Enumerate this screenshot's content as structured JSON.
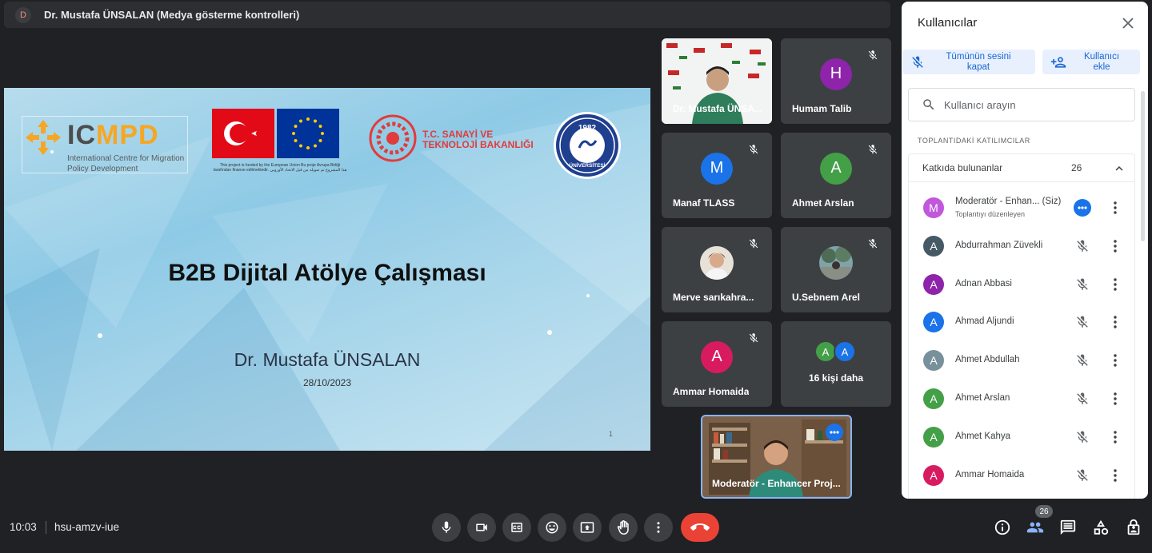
{
  "presenter": {
    "initial": "D",
    "title": "Dr. Mustafa ÜNSALAN (Medya gösterme kontrolleri)"
  },
  "slide": {
    "icmpd_name_a": "IC",
    "icmpd_name_b": "MPD",
    "icmpd_sub": "International Centre for Migration Policy Development",
    "eu_caption": "This project is funded by the European Union Bu proje Avrupa Birliği tarafından finanse edilmektedir. هذا المشروع تم تمويله من قبل الاتحاد الأوروبي",
    "ministry": "T.C. SANAYİ VE TEKNOLOJİ BAKANLIĞI",
    "uni_year": "1982",
    "uni_text": "ÜNİVERSİTESİ",
    "title": "B2B Dijital Atölye Çalışması",
    "author": "Dr. Mustafa ÜNSALAN",
    "date": "28/10/2023",
    "page": "1"
  },
  "tiles": [
    {
      "name": "Dr. Mustafa ÜNSA...",
      "type": "video"
    },
    {
      "name": "Humam Talib",
      "initial": "H",
      "color": "#8e24aa",
      "muted": true
    },
    {
      "name": "Manaf TLASS",
      "initial": "M",
      "color": "#1a73e8",
      "muted": true
    },
    {
      "name": "Ahmet Arslan",
      "initial": "A",
      "color": "#43a047",
      "muted": true
    },
    {
      "name": "Merve sarıkahra...",
      "type": "photo",
      "muted": true
    },
    {
      "name": "U.Sebnem Arel",
      "type": "photo",
      "muted": true
    },
    {
      "name": "Ammar Homaida",
      "initial": "A",
      "color": "#d81b60",
      "muted": true
    },
    {
      "more_label": "16 kişi daha",
      "initials": [
        "A",
        "A"
      ],
      "colors": [
        "#43a047",
        "#1a73e8"
      ]
    }
  ],
  "self_tile": {
    "name": "Moderatör - Enhancer Proj..."
  },
  "panel": {
    "title": "Kullanıcılar",
    "mute_all": "Tümünün sesini kapat",
    "add_user": "Kullanıcı ekle",
    "search_placeholder": "Kullanıcı arayın",
    "section": "TOPLANTIDAKİ KATILIMCILAR",
    "contributors_label": "Katkıda bulunanlar",
    "contributors_count": "26",
    "participants": [
      {
        "initial": "M",
        "color": "#c158dc",
        "name": "Moderatör - Enhan... (Siz)",
        "sub": "Toplantıyı düzenleyen",
        "speaking": true
      },
      {
        "initial": "A",
        "color": "#455a64",
        "name": "Abdurrahman Züvekli"
      },
      {
        "initial": "A",
        "color": "#8e24aa",
        "name": "Adnan Abbasi"
      },
      {
        "initial": "A",
        "color": "#1a73e8",
        "name": "Ahmad Aljundi"
      },
      {
        "initial": "A",
        "color": "#78909c",
        "name": "Ahmet Abdullah"
      },
      {
        "initial": "A",
        "color": "#43a047",
        "name": "Ahmet Arslan"
      },
      {
        "initial": "A",
        "color": "#43a047",
        "name": "Ahmet Kahya"
      },
      {
        "initial": "A",
        "color": "#d81b60",
        "name": "Ammar Homaida"
      }
    ]
  },
  "bottom": {
    "time": "10:03",
    "meeting_code": "hsu-amzv-iue",
    "people_count": "26"
  }
}
